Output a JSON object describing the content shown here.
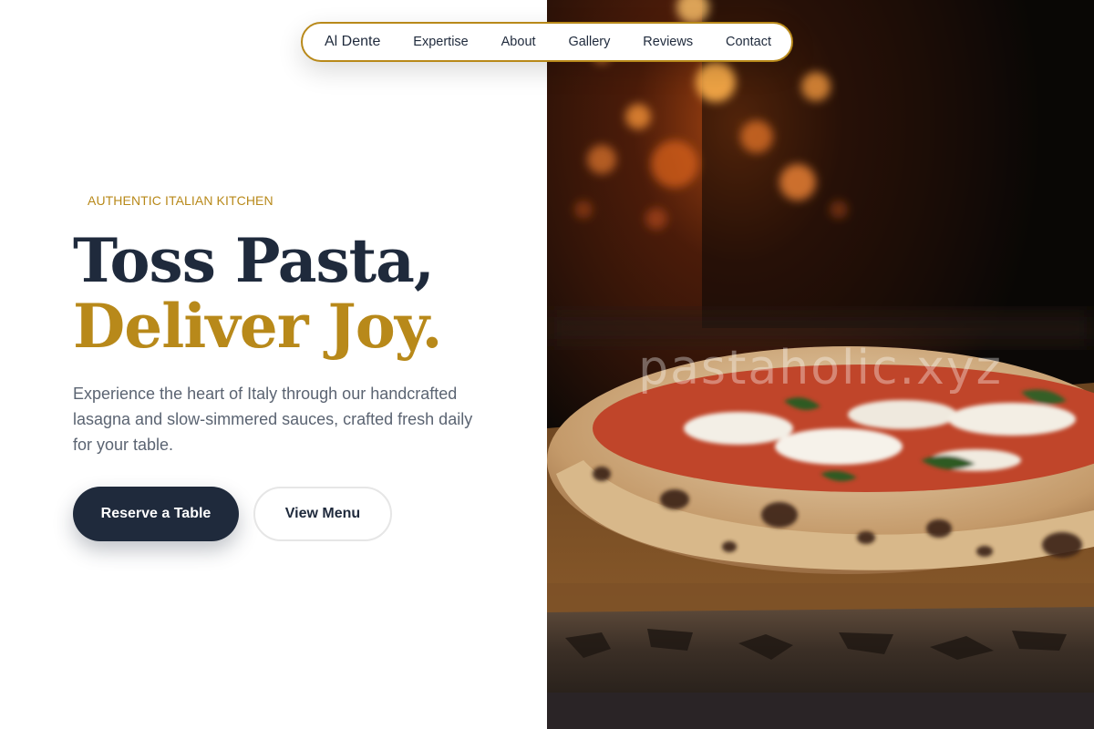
{
  "nav": {
    "brand": "Al Dente",
    "links": [
      "Expertise",
      "About",
      "Gallery",
      "Reviews",
      "Contact"
    ]
  },
  "hero": {
    "eyebrow": "AUTHENTIC ITALIAN KITCHEN",
    "headline_line1": "Toss Pasta,",
    "headline_line2": "Deliver Joy.",
    "description": "Experience the heart of Italy through our handcrafted lasagna and slow-simmered sauces, crafted fresh daily for your table.",
    "primary_button": "Reserve a Table",
    "secondary_button": "View Menu"
  },
  "image": {
    "watermark": "pastaholic.xyz",
    "subject": "wood-fired pizza on rustic wooden board with glowing oven fire in background"
  },
  "colors": {
    "navy": "#1f2a3c",
    "gold": "#b8891a",
    "body_text": "#5b6472",
    "background": "#ffffff"
  }
}
